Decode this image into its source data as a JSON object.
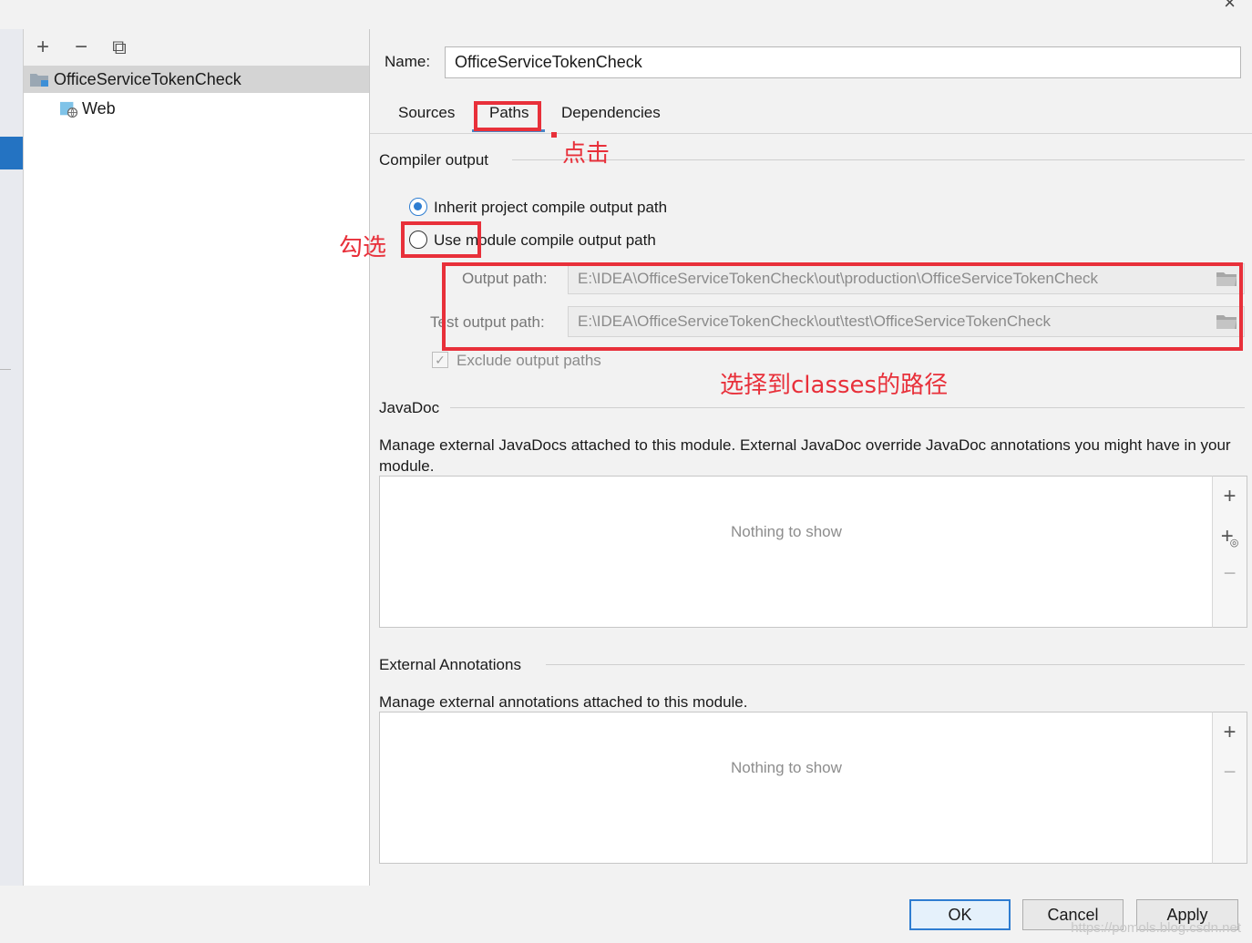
{
  "window": {
    "close_glyph": "×"
  },
  "tree": {
    "toolbar": {
      "add": "+",
      "remove": "−",
      "copy": "⧉"
    },
    "items": [
      {
        "label": "OfficeServiceTokenCheck",
        "icon": "module-folder-icon",
        "selected": true
      },
      {
        "label": "Web",
        "icon": "web-facet-icon",
        "selected": false
      }
    ]
  },
  "name_field": {
    "label": "Name:",
    "value": "OfficeServiceTokenCheck"
  },
  "tabs": [
    {
      "label": "Sources",
      "active": false
    },
    {
      "label": "Paths",
      "active": true
    },
    {
      "label": "Dependencies",
      "active": false
    }
  ],
  "compiler_output": {
    "title": "Compiler output",
    "options": [
      {
        "label": "Inherit project compile output path",
        "selected": true
      },
      {
        "label": "Use module compile output path",
        "selected": false
      }
    ],
    "output_path": {
      "label": "Output path:",
      "value": "E:\\IDEA\\OfficeServiceTokenCheck\\out\\production\\OfficeServiceTokenCheck"
    },
    "test_output_path": {
      "label": "Test output path:",
      "value": "E:\\IDEA\\OfficeServiceTokenCheck\\out\\test\\OfficeServiceTokenCheck"
    },
    "exclude": {
      "label": "Exclude output paths",
      "checked": true
    }
  },
  "javadoc": {
    "title": "JavaDoc",
    "description": "Manage external JavaDocs attached to this module. External JavaDoc override JavaDoc annotations you might have in your module.",
    "empty_text": "Nothing to show",
    "tools": {
      "add": "+",
      "add_url": "+",
      "remove": "−"
    }
  },
  "annotations": {
    "title": "External Annotations",
    "description": "Manage external annotations attached to this module.",
    "empty_text": "Nothing to show",
    "tools": {
      "add": "+",
      "remove": "−"
    }
  },
  "buttons": {
    "ok": "OK",
    "cancel": "Cancel",
    "apply": "Apply"
  },
  "annotations_overlay": {
    "click_note": "点击",
    "check_note": "勾选",
    "path_note": "选择到classes的路径",
    "color": "#e8303a"
  },
  "watermark": "https://pomols.blog.csdn.net"
}
